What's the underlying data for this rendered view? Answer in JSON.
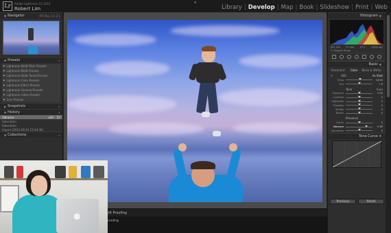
{
  "app": {
    "logo": "Lr",
    "title": "Adobe Lightroom CC 2015",
    "user": "Robert Lim"
  },
  "modules": [
    "Library",
    "Develop",
    "Map",
    "Book",
    "Slideshow",
    "Print",
    "Web"
  ],
  "active_module": "Develop",
  "left_panel": {
    "navigator": {
      "title": "Navigator",
      "zoom": "FIT FILL 1:1 3:1"
    },
    "presets": {
      "title": "Presets",
      "items": [
        "Lightroom B&W Filter Presets",
        "Lightroom B&W Presets",
        "Lightroom B&W Toned Presets",
        "Lightroom Color Presets",
        "Lightroom Effect Presets",
        "Lightroom General Presets",
        "Lightroom Video Presets",
        "User Presets"
      ]
    },
    "snapshots": {
      "title": "Snapshots"
    },
    "history": {
      "title": "History",
      "items": [
        {
          "label": "Vibrance",
          "v1": "+65",
          "v2": "57"
        },
        {
          "label": "Saturation",
          "v1": "",
          "v2": ""
        },
        {
          "label": "Saturation",
          "v1": "",
          "v2": ""
        },
        {
          "label": "Import (2011-08-14 13:44:36)",
          "v1": "",
          "v2": ""
        }
      ]
    },
    "collections": {
      "title": "Collections"
    }
  },
  "center": {
    "soft_proofing": "Soft Proofing"
  },
  "right_panel": {
    "histogram": {
      "title": "Histogram"
    },
    "camera_info": [
      "ISO 100",
      "17 mm",
      "f/7.1",
      "1/500 sec"
    ],
    "original_photo": "Original Photo",
    "basic": {
      "title": "Basic",
      "treatment_label": "Treatment :",
      "color": "Color",
      "bw": "Black & White",
      "wb_label": "WB :",
      "wb_value": "As Shot",
      "tone_title": "Tone",
      "auto_label": "Auto",
      "presence_title": "Presence",
      "sliders_a": [
        {
          "name": "Temp",
          "value": "5,600",
          "pos": 0.55
        },
        {
          "name": "Tint",
          "value": "+ 8",
          "pos": 0.52
        }
      ],
      "sliders_b": [
        {
          "name": "Exposure",
          "value": "0.00",
          "pos": 0.5
        },
        {
          "name": "Contrast",
          "value": "0",
          "pos": 0.5
        },
        {
          "name": "Highlights",
          "value": "0",
          "pos": 0.5
        },
        {
          "name": "Shadows",
          "value": "0",
          "pos": 0.5
        },
        {
          "name": "Whites",
          "value": "0",
          "pos": 0.5
        },
        {
          "name": "Blacks",
          "value": "0",
          "pos": 0.5
        }
      ],
      "sliders_c": [
        {
          "name": "Clarity",
          "value": "0",
          "pos": 0.5,
          "hl": false
        },
        {
          "name": "Vibrance",
          "value": "+ 57",
          "pos": 0.78,
          "hl": true
        },
        {
          "name": "Saturation",
          "value": "0",
          "pos": 0.5,
          "hl": false
        }
      ]
    },
    "tone_curve": {
      "title": "Tone Curve"
    },
    "buttons": {
      "previous": "Previous",
      "reset": "Reset"
    }
  },
  "toolbar": {
    "filter_label": "Filter :",
    "filter_value": "Filters Off",
    "film_label": "Grading"
  },
  "colors": {
    "accent_sky": "#5a80e2",
    "shirt_blue": "#1a8ad6",
    "presenter_top": "#2fb5c0"
  }
}
